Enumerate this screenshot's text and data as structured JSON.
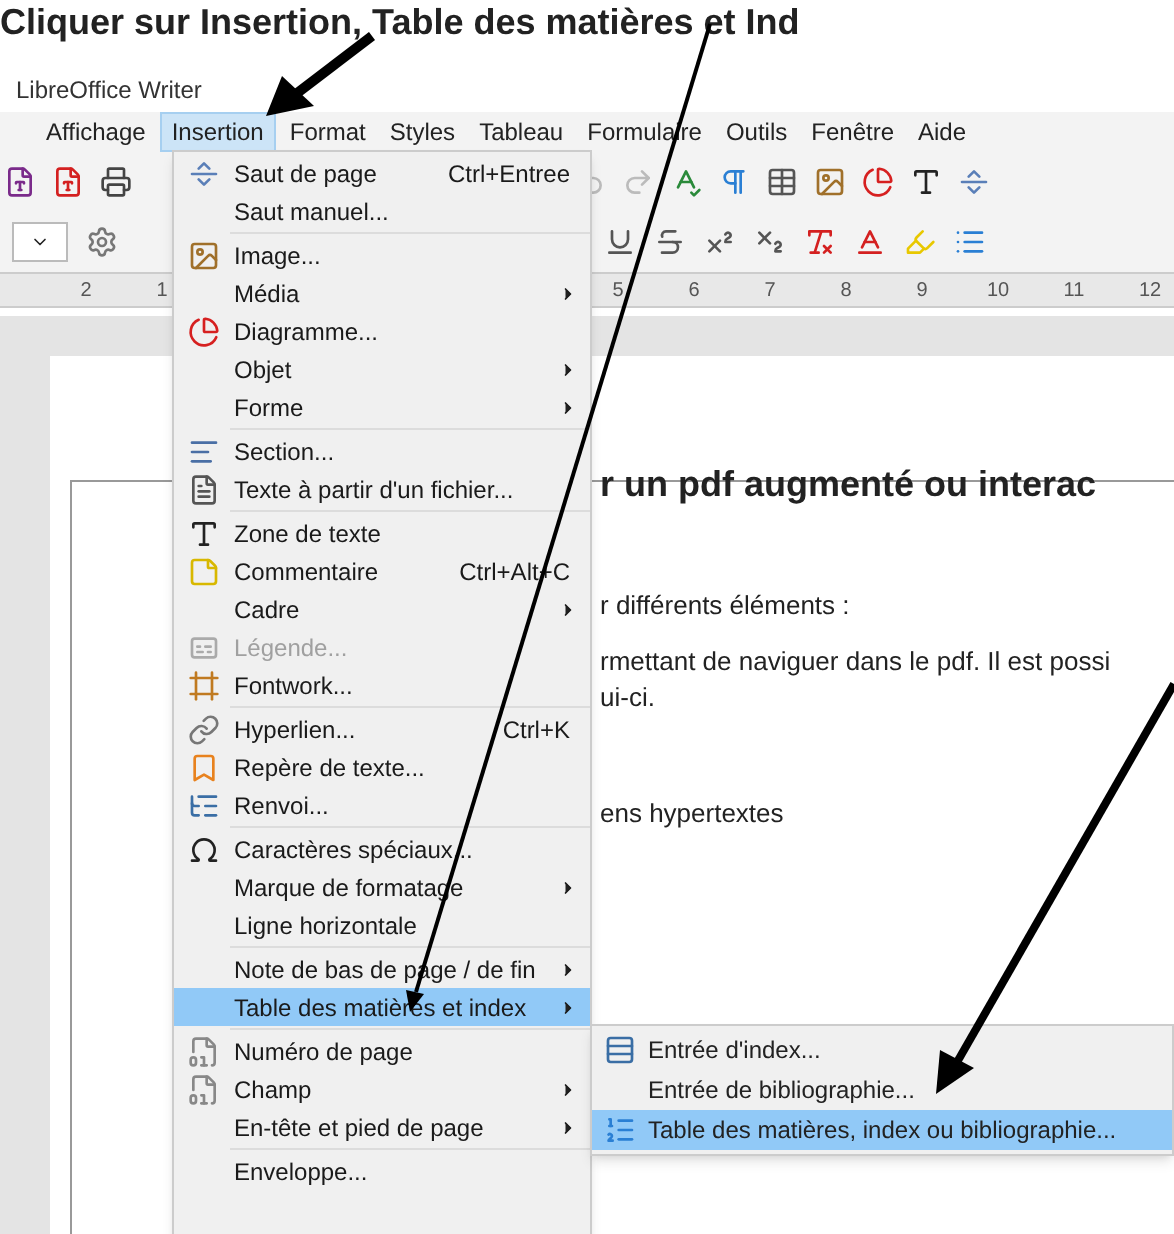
{
  "caption": "Cliquer sur Insertion, Table des matières et Ind",
  "window": {
    "title": "LibreOffice Writer"
  },
  "menubar": [
    {
      "label": "Affichage",
      "selected": false
    },
    {
      "label": "Insertion",
      "selected": true
    },
    {
      "label": "Format",
      "selected": false
    },
    {
      "label": "Styles",
      "selected": false
    },
    {
      "label": "Tableau",
      "selected": false
    },
    {
      "label": "Formulaire",
      "selected": false
    },
    {
      "label": "Outils",
      "selected": false
    },
    {
      "label": "Fenêtre",
      "selected": false
    },
    {
      "label": "Aide",
      "selected": false
    }
  ],
  "ruler": {
    "left_labels": [
      "2",
      "1"
    ],
    "right_labels": [
      "5",
      "6",
      "7",
      "8",
      "9",
      "10",
      "11",
      "12"
    ]
  },
  "document": {
    "heading": "r un pdf augmenté ou interac",
    "lines": [
      "r différents éléments :",
      "rmettant de naviguer dans le pdf. Il est possi",
      "ui-ci.",
      "ens hypertextes"
    ]
  },
  "menu": {
    "groups": [
      [
        {
          "label": "Saut de page",
          "shortcut": "Ctrl+Entree",
          "submenu": false,
          "disabled": false,
          "selected": false
        },
        {
          "label": "Saut manuel...",
          "submenu": false,
          "disabled": false,
          "selected": false
        }
      ],
      [
        {
          "label": "Image...",
          "submenu": false,
          "disabled": false,
          "selected": false
        },
        {
          "label": "Média",
          "submenu": true,
          "disabled": false,
          "selected": false
        },
        {
          "label": "Diagramme...",
          "submenu": false,
          "disabled": false,
          "selected": false
        },
        {
          "label": "Objet",
          "submenu": true,
          "disabled": false,
          "selected": false
        },
        {
          "label": "Forme",
          "submenu": true,
          "disabled": false,
          "selected": false
        }
      ],
      [
        {
          "label": "Section...",
          "submenu": false,
          "disabled": false,
          "selected": false
        },
        {
          "label": "Texte à partir d'un fichier...",
          "submenu": false,
          "disabled": false,
          "selected": false
        }
      ],
      [
        {
          "label": "Zone de texte",
          "submenu": false,
          "disabled": false,
          "selected": false
        },
        {
          "label": "Commentaire",
          "shortcut": "Ctrl+Alt+C",
          "submenu": false,
          "disabled": false,
          "selected": false
        },
        {
          "label": "Cadre",
          "submenu": true,
          "disabled": false,
          "selected": false
        },
        {
          "label": "Légende...",
          "submenu": false,
          "disabled": true,
          "selected": false
        },
        {
          "label": "Fontwork...",
          "submenu": false,
          "disabled": false,
          "selected": false
        }
      ],
      [
        {
          "label": "Hyperlien...",
          "shortcut": "Ctrl+K",
          "submenu": false,
          "disabled": false,
          "selected": false
        },
        {
          "label": "Repère de texte...",
          "submenu": false,
          "disabled": false,
          "selected": false
        },
        {
          "label": "Renvoi...",
          "submenu": false,
          "disabled": false,
          "selected": false
        }
      ],
      [
        {
          "label": "Caractères spéciaux...",
          "submenu": false,
          "disabled": false,
          "selected": false
        },
        {
          "label": "Marque de formatage",
          "submenu": true,
          "disabled": false,
          "selected": false
        },
        {
          "label": "Ligne horizontale",
          "submenu": false,
          "disabled": false,
          "selected": false
        }
      ],
      [
        {
          "label": "Note de bas de page / de fin",
          "submenu": true,
          "disabled": false,
          "selected": false
        },
        {
          "label": "Table des matières et index",
          "submenu": true,
          "disabled": false,
          "selected": true
        }
      ],
      [
        {
          "label": "Numéro de page",
          "submenu": false,
          "disabled": false,
          "selected": false
        },
        {
          "label": "Champ",
          "submenu": true,
          "disabled": false,
          "selected": false
        },
        {
          "label": "En-tête et pied de page",
          "submenu": true,
          "disabled": false,
          "selected": false
        }
      ],
      [
        {
          "label": "Enveloppe...",
          "submenu": false,
          "disabled": false,
          "selected": false
        }
      ]
    ]
  },
  "submenu": [
    {
      "label": "Entrée d'index...",
      "selected": false
    },
    {
      "label": "Entrée de bibliographie...",
      "selected": false
    },
    {
      "label": "Table des matières, index ou bibliographie...",
      "selected": true
    }
  ]
}
